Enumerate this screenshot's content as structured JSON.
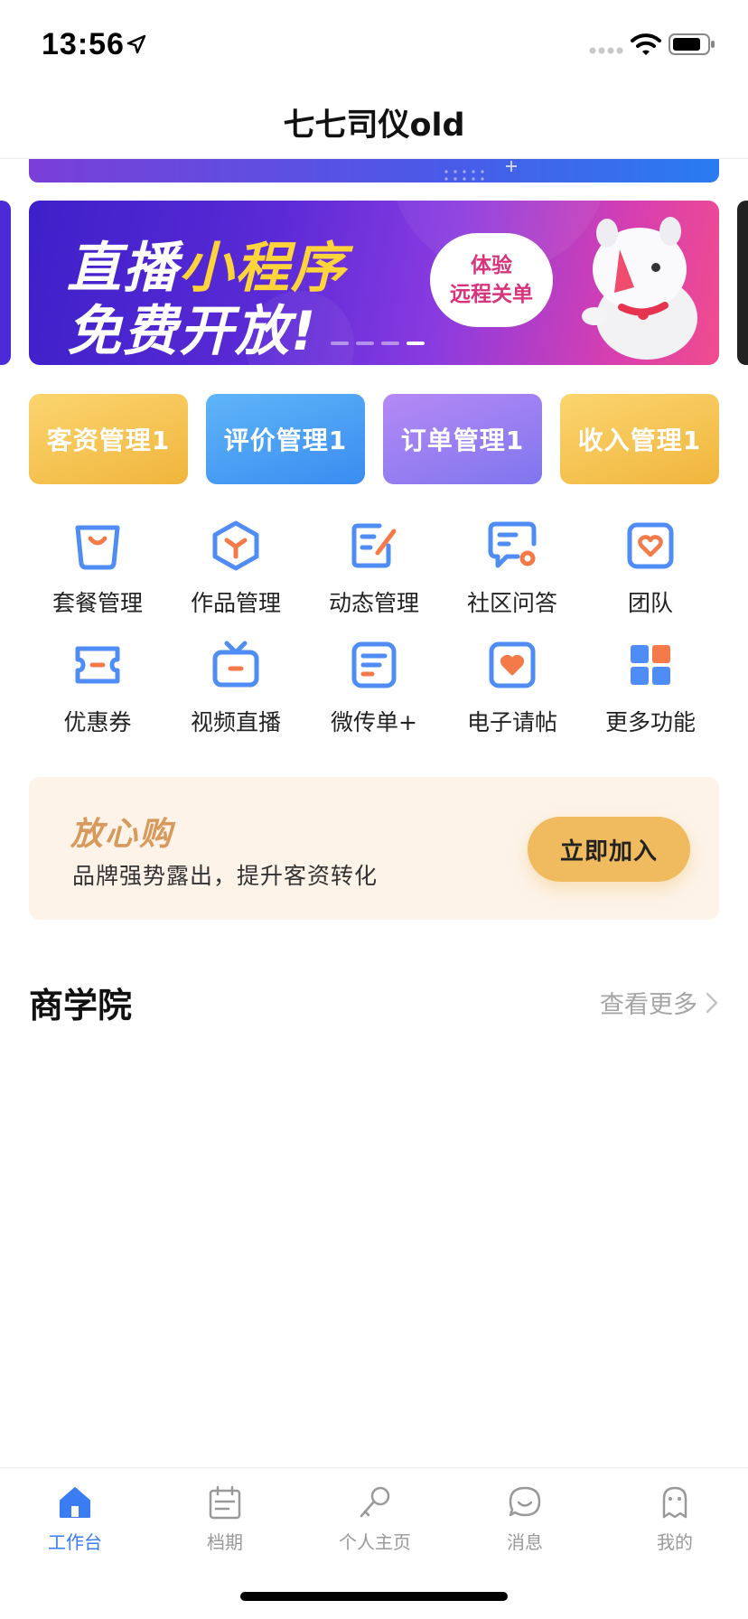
{
  "status_bar": {
    "time": "13:56"
  },
  "nav": {
    "title": "七七司仪old"
  },
  "banner": {
    "line1_part1": "直播",
    "line1_part2": "小程序",
    "line2": "免费开放!",
    "badge_line1": "体验",
    "badge_line2": "远程关单",
    "slide_count": 4,
    "active_slide": 4
  },
  "quick_buttons": [
    "客资管理1",
    "评价管理1",
    "订单管理1",
    "收入管理1"
  ],
  "features": [
    {
      "label": "套餐管理",
      "icon": "bag-icon"
    },
    {
      "label": "作品管理",
      "icon": "cube-icon"
    },
    {
      "label": "动态管理",
      "icon": "edit-note-icon"
    },
    {
      "label": "社区问答",
      "icon": "chat-bubble-icon"
    },
    {
      "label": "团队",
      "icon": "heart-card-icon"
    },
    {
      "label": "优惠券",
      "icon": "coupon-icon"
    },
    {
      "label": "视频直播",
      "icon": "tv-icon"
    },
    {
      "label": "微传单+",
      "icon": "document-icon"
    },
    {
      "label": "电子请帖",
      "icon": "invitation-icon"
    },
    {
      "label": "更多功能",
      "icon": "grid-icon"
    }
  ],
  "promo": {
    "logo": "放心购",
    "subtitle": "品牌强势露出，提升客资转化",
    "button": "立即加入"
  },
  "academy": {
    "title": "商学院",
    "more": "查看更多"
  },
  "tabs": [
    {
      "label": "工作台",
      "icon": "home-icon",
      "active": true
    },
    {
      "label": "档期",
      "icon": "calendar-icon",
      "active": false
    },
    {
      "label": "个人主页",
      "icon": "microphone-icon",
      "active": false
    },
    {
      "label": "消息",
      "icon": "message-icon",
      "active": false
    },
    {
      "label": "我的",
      "icon": "profile-icon",
      "active": false
    }
  ],
  "colors": {
    "accent": "#3a7cf2",
    "icon_blue": "#4f8df5",
    "icon_orange": "#f57a4a",
    "gold": "#efbb5e",
    "promo_bg": "#fdf3e8"
  }
}
